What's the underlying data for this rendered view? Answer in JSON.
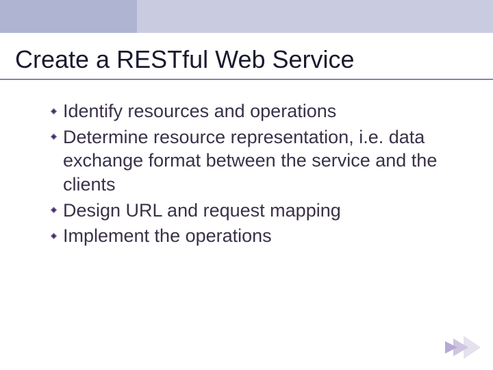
{
  "slide": {
    "title": "Create a RESTful Web Service",
    "bullets": [
      "Identify resources and operations",
      "Determine resource representation, i.e. data exchange format between the service and the clients",
      "Design URL and request mapping",
      "Implement the operations"
    ]
  },
  "colors": {
    "topbar_light": "#c9cce1",
    "topbar_dark": "#b0b4d3",
    "title": "#1a1a2e",
    "body": "#3a3148",
    "bullet_accent": "#7a5e9e",
    "bullet_dark": "#3a2f55"
  }
}
